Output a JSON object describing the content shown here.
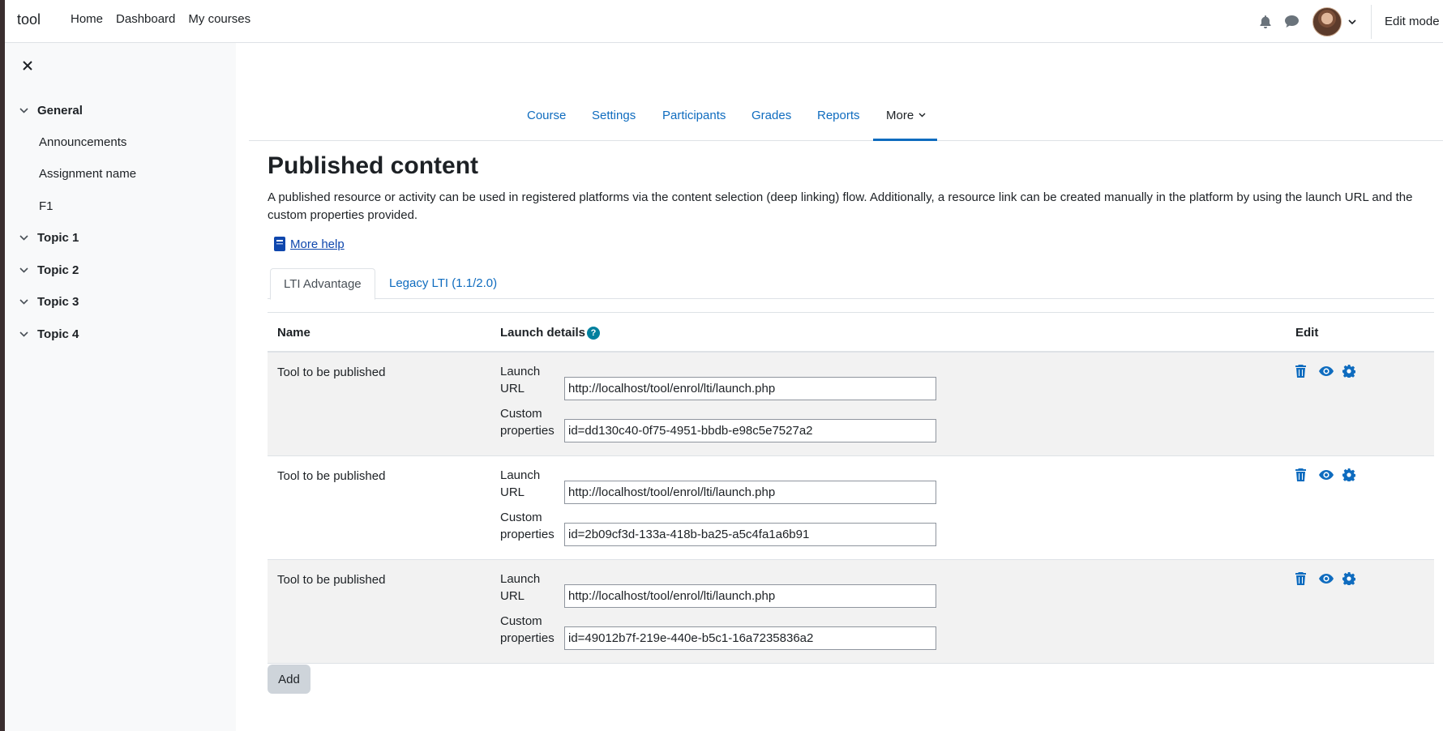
{
  "navbar": {
    "brand": "tool",
    "links": [
      "Home",
      "Dashboard",
      "My courses"
    ],
    "edit_mode": "Edit mode"
  },
  "drawer": {
    "sections": [
      {
        "title": "General",
        "activities": [
          "Announcements",
          "Assignment name",
          "F1"
        ]
      },
      {
        "title": "Topic 1",
        "activities": []
      },
      {
        "title": "Topic 2",
        "activities": []
      },
      {
        "title": "Topic 3",
        "activities": []
      },
      {
        "title": "Topic 4",
        "activities": []
      }
    ]
  },
  "secondary_nav": {
    "tabs": [
      "Course",
      "Settings",
      "Participants",
      "Grades",
      "Reports",
      "More"
    ],
    "active": "More"
  },
  "page": {
    "title": "Published content",
    "intro": "A published resource or activity can be used in registered platforms via the content selection (deep linking) flow. Additionally, a resource link can be created manually in the platform by using the launch URL and the custom properties provided.",
    "help_link": "More help"
  },
  "tabs": [
    {
      "label": "LTI Advantage",
      "active": true
    },
    {
      "label": "Legacy LTI (1.1/2.0)",
      "active": false
    }
  ],
  "table": {
    "headers": {
      "name": "Name",
      "launch_details": "Launch details",
      "edit": "Edit"
    },
    "launch_url_label": "Launch URL",
    "custom_properties_label": "Custom properties",
    "rows": [
      {
        "name": "Tool to be published",
        "launch_url": "http://localhost/tool/enrol/lti/launch.php",
        "custom_properties": "id=dd130c40-0f75-4951-bbdb-e98c5e7527a2"
      },
      {
        "name": "Tool to be published",
        "launch_url": "http://localhost/tool/enrol/lti/launch.php",
        "custom_properties": "id=2b09cf3d-133a-418b-ba25-a5c4fa1a6b91"
      },
      {
        "name": "Tool to be published",
        "launch_url": "http://localhost/tool/enrol/lti/launch.php",
        "custom_properties": "id=49012b7f-219e-440e-b5c1-16a7235836a2"
      }
    ]
  },
  "add_button": "Add",
  "colors": {
    "link": "#0f6cbf",
    "help_icon": "#00809e",
    "drawer_bg": "#f8f9fa",
    "row_stripe": "#f2f2f2"
  }
}
